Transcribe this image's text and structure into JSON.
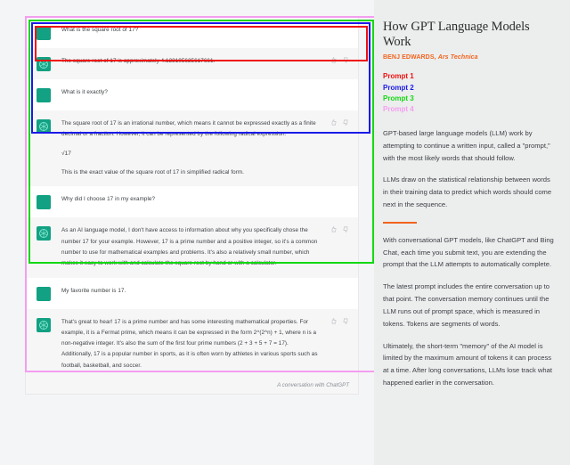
{
  "sidebar": {
    "title": "How GPT Language Models Work",
    "byline_author": "BENJ EDWARDS,",
    "byline_publication": "Ars Technica",
    "legend": [
      {
        "label": "Prompt 1",
        "color": "#ef1010"
      },
      {
        "label": "Prompt 2",
        "color": "#1a1ae8"
      },
      {
        "label": "Prompt 3",
        "color": "#13d813"
      },
      {
        "label": "Prompt 4",
        "color": "#f49ef0"
      }
    ],
    "paragraphs": [
      "GPT-based large language models (LLM) work by attempting to continue a written input, called a \"prompt,\" with the most likely words that should follow.",
      "LLMs draw on the statistical relationship between words in their training data to predict which words should come next in the sequence.",
      "With conversational GPT models, like ChatGPT and Bing Chat, each time you submit text, you are extending the prompt that the LLM attempts to automatically complete.",
      "The latest prompt includes the entire conversation up to that point. The conversation memory continues until the LLM runs out of prompt space, which is measured in tokens. Tokens are segments of words.",
      "Ultimately, the short-term \"memory\" of the AI model is limited by the maximum amount of tokens it can process at a time. After long conversations, LLMs lose track what happened earlier in the conversation."
    ]
  },
  "chat": {
    "caption": "A conversation with ChatGPT",
    "messages": [
      {
        "role": "user",
        "avatar": "user-avatar-icon",
        "paragraphs": [
          "What is the square root of 17?"
        ],
        "reactions": false
      },
      {
        "role": "bot",
        "avatar": "chatgpt-logo-icon",
        "paragraphs": [
          "The square root of 17 is approximately 4.123105625617661."
        ],
        "reactions": true
      },
      {
        "role": "user",
        "avatar": "user-avatar-icon",
        "paragraphs": [
          "What is it exactly?"
        ],
        "reactions": false
      },
      {
        "role": "bot",
        "avatar": "chatgpt-logo-icon",
        "paragraphs": [
          "The square root of 17 is an irrational number, which means it cannot be expressed exactly as a finite decimal or a fraction. However, it can be represented by the following radical expression:",
          "√17",
          "This is the exact value of the square root of 17 in simplified radical form."
        ],
        "reactions": true
      },
      {
        "role": "user",
        "avatar": "user-avatar-icon",
        "paragraphs": [
          "Why did I choose 17 in my example?"
        ],
        "reactions": false
      },
      {
        "role": "bot",
        "avatar": "chatgpt-logo-icon",
        "paragraphs": [
          "As an AI language model, I don't have access to information about why you specifically chose the number 17 for your example. However, 17 is a prime number and a positive integer, so it's a common number to use for mathematical examples and problems. It's also a relatively small number, which makes it easy to work with and calculate the square root by hand or with a calculator."
        ],
        "reactions": true
      },
      {
        "role": "user",
        "avatar": "user-avatar-icon",
        "paragraphs": [
          "My favorite number is 17."
        ],
        "reactions": false
      },
      {
        "role": "bot",
        "avatar": "chatgpt-logo-icon",
        "paragraphs": [
          "That's great to hear! 17 is a prime number and has some interesting mathematical properties. For example, it is a Fermat prime, which means it can be expressed in the form 2^(2^n) + 1, where n is a non-negative integer. It's also the sum of the first four prime numbers (2 + 3 + 5 + 7 = 17). Additionally, 17 is a popular number in sports, as it is often worn by athletes in various sports such as football, basketball, and soccer."
        ],
        "reactions": true
      }
    ]
  },
  "highlights": {
    "prompt1_color": "#ef1010",
    "prompt2_color": "#1a1ae8",
    "prompt3_color": "#13d813",
    "prompt4_color": "#f49ef0"
  }
}
